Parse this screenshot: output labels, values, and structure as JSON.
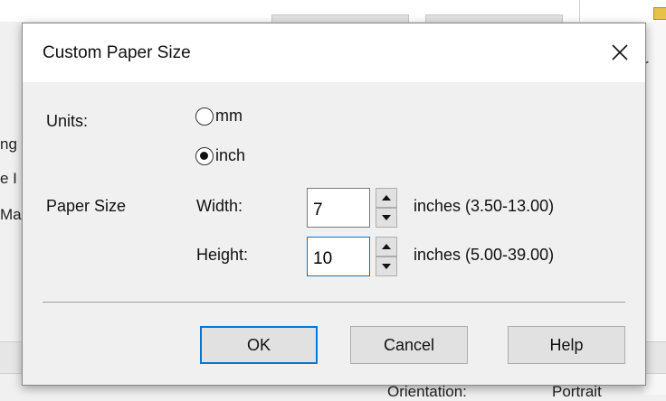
{
  "background": {
    "fragments": [
      "ng",
      "e I",
      "Ma",
      "r",
      "Orientation:",
      "Portrait"
    ]
  },
  "dialog": {
    "title": "Custom Paper Size",
    "units_label": "Units:",
    "units_options": [
      {
        "label": "mm",
        "selected": false
      },
      {
        "label": "inch",
        "selected": true
      }
    ],
    "paper_size_label": "Paper Size",
    "width": {
      "label": "Width:",
      "value": "7",
      "range": "inches (3.50-13.00)"
    },
    "height": {
      "label": "Height:",
      "value": "10",
      "range": "inches (5.00-39.00)"
    },
    "buttons": {
      "ok": "OK",
      "cancel": "Cancel",
      "help": "Help"
    }
  },
  "icons": {
    "close": "close-icon",
    "spin_up": "triangle-up-icon",
    "spin_down": "triangle-down-icon",
    "folder": "folder-icon"
  },
  "colors": {
    "accent": "#0078d7",
    "dialog_bg": "#f0f0f0",
    "titlebar_bg": "#ffffff"
  }
}
